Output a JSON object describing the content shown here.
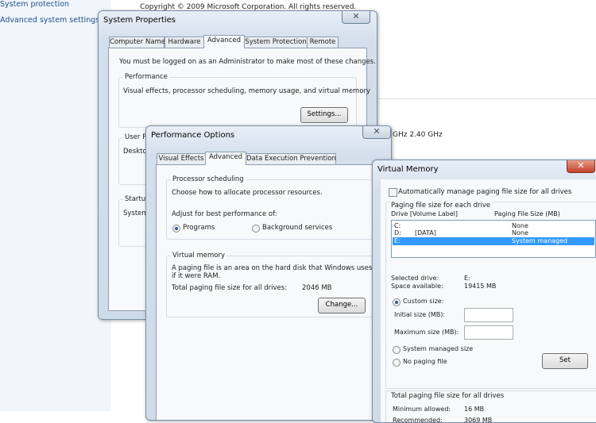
{
  "left_pane": {
    "links": [
      "System protection",
      "Advanced system settings"
    ]
  },
  "background": {
    "copyright": "Copyright © 2009 Microsoft Corporation.  All rights reserved.",
    "cpu_speed": "GHz  2.40 GHz"
  },
  "system_properties": {
    "title": "System Properties",
    "close": "✕",
    "tabs": [
      "Computer Name",
      "Hardware",
      "Advanced",
      "System Protection",
      "Remote"
    ],
    "admin_note": "You must be logged on as an Administrator to make most of these changes.",
    "performance": {
      "label": "Performance",
      "desc": "Visual effects, processor scheduling, memory usage, and virtual memory",
      "settings_button": "Settings..."
    },
    "user_profiles": {
      "label": "User Pr",
      "desc": "Deskto"
    },
    "startup": {
      "label": "Startup",
      "desc": "System"
    }
  },
  "performance_options": {
    "title": "Performance Options",
    "close": "✕",
    "tabs": [
      "Visual Effects",
      "Advanced",
      "Data Execution Prevention"
    ],
    "processor": {
      "label": "Processor scheduling",
      "desc": "Choose how to allocate processor resources.",
      "adjust": "Adjust for best performance of:",
      "programs": "Programs",
      "background": "Background services",
      "selected": "Programs"
    },
    "virtual_memory": {
      "label": "Virtual memory",
      "desc_line1": "A paging file is an area on the hard disk that Windows uses as",
      "desc_line2": "if it were RAM.",
      "total_label": "Total paging file size for all drives:",
      "total_value": "2046 MB",
      "change_button": "Change..."
    }
  },
  "virtual_memory": {
    "title": "Virtual Memory",
    "close": "✕",
    "auto_manage": "Automatically manage paging file size for all drives",
    "auto_manage_checked": false,
    "paging_label": "Paging file size for each drive",
    "col_drive": "Drive  [Volume Label]",
    "col_size": "Paging File Size (MB)",
    "drives": [
      {
        "drive": "C:",
        "label": "",
        "size": "None"
      },
      {
        "drive": "D:",
        "label": "[DATA]",
        "size": "None"
      },
      {
        "drive": "E:",
        "label": "",
        "size": "System managed"
      }
    ],
    "selected_index": 2,
    "selected_drive_label": "Selected drive:",
    "selected_drive_value": "E:",
    "space_label": "Space available:",
    "space_value": "19415 MB",
    "custom_size": "Custom size:",
    "initial_size": "Initial size (MB):",
    "initial_value": "",
    "maximum_size": "Maximum size (MB):",
    "maximum_value": "",
    "system_managed": "System managed size",
    "no_paging": "No paging file",
    "set_button": "Set",
    "total_label": "Total paging file size for all drives",
    "min_label": "Minimum allowed:",
    "min_value": "16 MB",
    "rec_label": "Recommended:",
    "rec_value": "3069 MB"
  }
}
